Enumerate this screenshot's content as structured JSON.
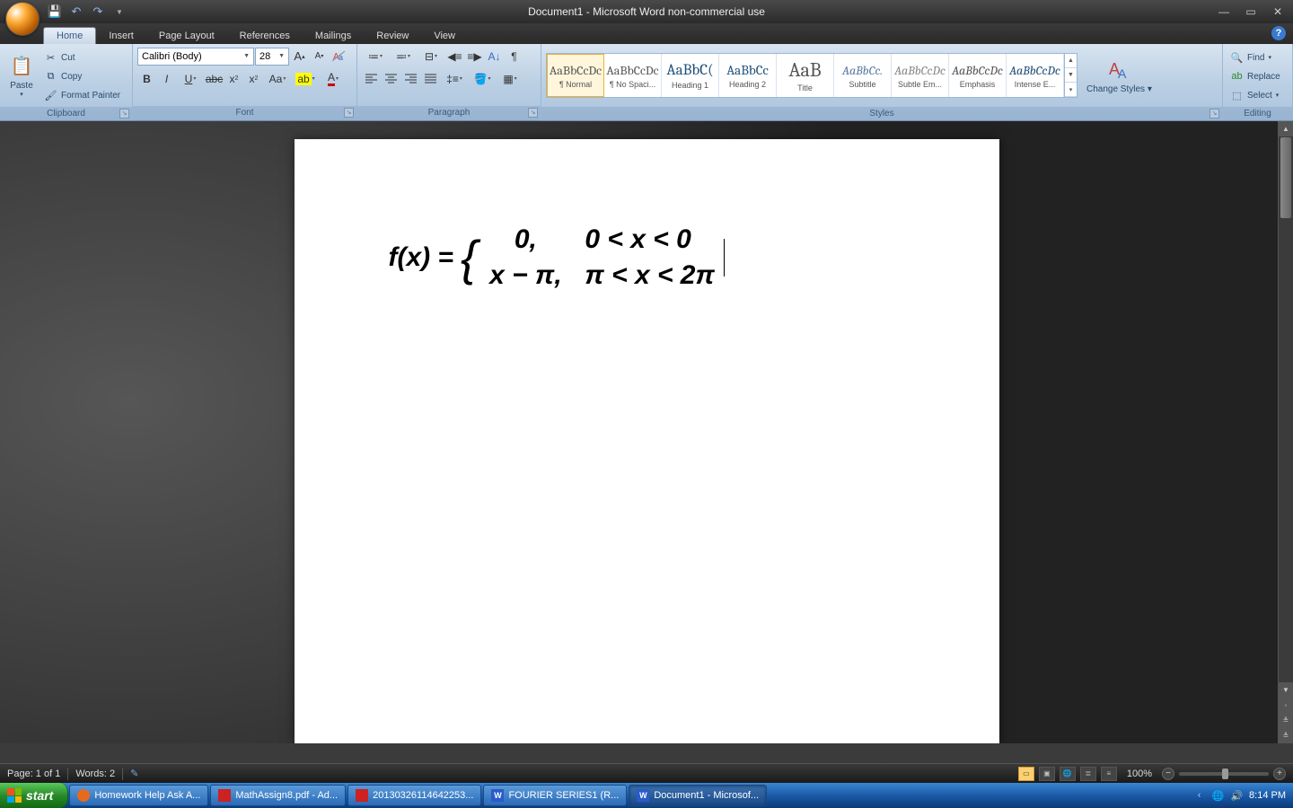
{
  "titlebar": {
    "title": "Document1 - Microsoft Word non-commercial use",
    "qat": {
      "save": "💾",
      "undo": "↶",
      "redo": "↷"
    }
  },
  "tabs": [
    "Home",
    "Insert",
    "Page Layout",
    "References",
    "Mailings",
    "Review",
    "View"
  ],
  "active_tab": "Home",
  "ribbon": {
    "clipboard": {
      "label": "Clipboard",
      "paste": "Paste",
      "cut": "Cut",
      "copy": "Copy",
      "format_painter": "Format Painter"
    },
    "font": {
      "label": "Font",
      "name": "Calibri (Body)",
      "size": "28"
    },
    "paragraph": {
      "label": "Paragraph"
    },
    "styles": {
      "label": "Styles",
      "items": [
        {
          "preview": "AaBbCcDc",
          "name": "¶ Normal",
          "color": "#000"
        },
        {
          "preview": "AaBbCcDc",
          "name": "¶ No Spaci...",
          "color": "#000"
        },
        {
          "preview": "AaBbC(",
          "name": "Heading 1",
          "color": "#1e4e79",
          "size": "17px"
        },
        {
          "preview": "AaBbCc",
          "name": "Heading 2",
          "color": "#1e4e79",
          "size": "15px"
        },
        {
          "preview": "AaB",
          "name": "Title",
          "color": "#000",
          "size": "22px"
        },
        {
          "preview": "AaBbCc.",
          "name": "Subtitle",
          "color": "#5a7aa0",
          "style": "italic"
        },
        {
          "preview": "AaBbCcDc",
          "name": "Subtle Em...",
          "color": "#888",
          "style": "italic"
        },
        {
          "preview": "AaBbCcDc",
          "name": "Emphasis",
          "color": "#000",
          "style": "italic"
        },
        {
          "preview": "AaBbCcDc",
          "name": "Intense E...",
          "color": "#1e4e79",
          "style": "italic"
        }
      ],
      "change_styles": "Change Styles"
    },
    "editing": {
      "label": "Editing",
      "find": "Find",
      "replace": "Replace",
      "select": "Select"
    }
  },
  "document": {
    "equation": {
      "lhs": "f(x)  =",
      "case1_expr": "0,",
      "case1_cond": "0 < x < 0",
      "case2_expr": "x − π,",
      "case2_cond": "π < x < 2π"
    }
  },
  "statusbar": {
    "page": "Page: 1 of 1",
    "words": "Words: 2",
    "zoom": "100%"
  },
  "taskbar": {
    "start": "start",
    "items": [
      {
        "label": "Homework Help Ask A...",
        "icon": "🦊",
        "bg": "#e66a1e"
      },
      {
        "label": "MathAssign8.pdf - Ad...",
        "icon": "📕",
        "bg": "#c22"
      },
      {
        "label": "20130326114642253...",
        "icon": "📕",
        "bg": "#c22"
      },
      {
        "label": "FOURIER SERIES1 (R...",
        "icon": "W",
        "bg": "#2a5aca"
      },
      {
        "label": "Document1 - Microsof...",
        "icon": "W",
        "bg": "#2a5aca",
        "active": true
      }
    ],
    "clock": "8:14 PM"
  }
}
